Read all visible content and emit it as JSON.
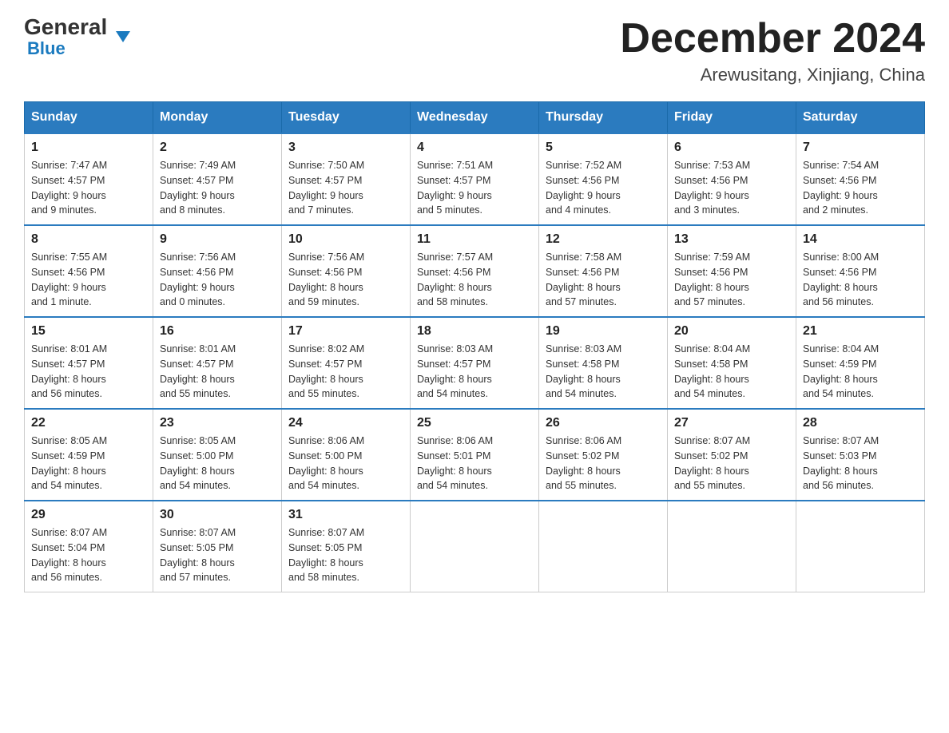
{
  "header": {
    "logo_general": "General",
    "logo_blue": "Blue",
    "month_title": "December 2024",
    "location": "Arewusitang, Xinjiang, China"
  },
  "days_of_week": [
    "Sunday",
    "Monday",
    "Tuesday",
    "Wednesday",
    "Thursday",
    "Friday",
    "Saturday"
  ],
  "weeks": [
    [
      {
        "day": "1",
        "sunrise": "7:47 AM",
        "sunset": "4:57 PM",
        "daylight": "9 hours and 9 minutes."
      },
      {
        "day": "2",
        "sunrise": "7:49 AM",
        "sunset": "4:57 PM",
        "daylight": "9 hours and 8 minutes."
      },
      {
        "day": "3",
        "sunrise": "7:50 AM",
        "sunset": "4:57 PM",
        "daylight": "9 hours and 7 minutes."
      },
      {
        "day": "4",
        "sunrise": "7:51 AM",
        "sunset": "4:57 PM",
        "daylight": "9 hours and 5 minutes."
      },
      {
        "day": "5",
        "sunrise": "7:52 AM",
        "sunset": "4:56 PM",
        "daylight": "9 hours and 4 minutes."
      },
      {
        "day": "6",
        "sunrise": "7:53 AM",
        "sunset": "4:56 PM",
        "daylight": "9 hours and 3 minutes."
      },
      {
        "day": "7",
        "sunrise": "7:54 AM",
        "sunset": "4:56 PM",
        "daylight": "9 hours and 2 minutes."
      }
    ],
    [
      {
        "day": "8",
        "sunrise": "7:55 AM",
        "sunset": "4:56 PM",
        "daylight": "9 hours and 1 minute."
      },
      {
        "day": "9",
        "sunrise": "7:56 AM",
        "sunset": "4:56 PM",
        "daylight": "9 hours and 0 minutes."
      },
      {
        "day": "10",
        "sunrise": "7:56 AM",
        "sunset": "4:56 PM",
        "daylight": "8 hours and 59 minutes."
      },
      {
        "day": "11",
        "sunrise": "7:57 AM",
        "sunset": "4:56 PM",
        "daylight": "8 hours and 58 minutes."
      },
      {
        "day": "12",
        "sunrise": "7:58 AM",
        "sunset": "4:56 PM",
        "daylight": "8 hours and 57 minutes."
      },
      {
        "day": "13",
        "sunrise": "7:59 AM",
        "sunset": "4:56 PM",
        "daylight": "8 hours and 57 minutes."
      },
      {
        "day": "14",
        "sunrise": "8:00 AM",
        "sunset": "4:56 PM",
        "daylight": "8 hours and 56 minutes."
      }
    ],
    [
      {
        "day": "15",
        "sunrise": "8:01 AM",
        "sunset": "4:57 PM",
        "daylight": "8 hours and 56 minutes."
      },
      {
        "day": "16",
        "sunrise": "8:01 AM",
        "sunset": "4:57 PM",
        "daylight": "8 hours and 55 minutes."
      },
      {
        "day": "17",
        "sunrise": "8:02 AM",
        "sunset": "4:57 PM",
        "daylight": "8 hours and 55 minutes."
      },
      {
        "day": "18",
        "sunrise": "8:03 AM",
        "sunset": "4:57 PM",
        "daylight": "8 hours and 54 minutes."
      },
      {
        "day": "19",
        "sunrise": "8:03 AM",
        "sunset": "4:58 PM",
        "daylight": "8 hours and 54 minutes."
      },
      {
        "day": "20",
        "sunrise": "8:04 AM",
        "sunset": "4:58 PM",
        "daylight": "8 hours and 54 minutes."
      },
      {
        "day": "21",
        "sunrise": "8:04 AM",
        "sunset": "4:59 PM",
        "daylight": "8 hours and 54 minutes."
      }
    ],
    [
      {
        "day": "22",
        "sunrise": "8:05 AM",
        "sunset": "4:59 PM",
        "daylight": "8 hours and 54 minutes."
      },
      {
        "day": "23",
        "sunrise": "8:05 AM",
        "sunset": "5:00 PM",
        "daylight": "8 hours and 54 minutes."
      },
      {
        "day": "24",
        "sunrise": "8:06 AM",
        "sunset": "5:00 PM",
        "daylight": "8 hours and 54 minutes."
      },
      {
        "day": "25",
        "sunrise": "8:06 AM",
        "sunset": "5:01 PM",
        "daylight": "8 hours and 54 minutes."
      },
      {
        "day": "26",
        "sunrise": "8:06 AM",
        "sunset": "5:02 PM",
        "daylight": "8 hours and 55 minutes."
      },
      {
        "day": "27",
        "sunrise": "8:07 AM",
        "sunset": "5:02 PM",
        "daylight": "8 hours and 55 minutes."
      },
      {
        "day": "28",
        "sunrise": "8:07 AM",
        "sunset": "5:03 PM",
        "daylight": "8 hours and 56 minutes."
      }
    ],
    [
      {
        "day": "29",
        "sunrise": "8:07 AM",
        "sunset": "5:04 PM",
        "daylight": "8 hours and 56 minutes."
      },
      {
        "day": "30",
        "sunrise": "8:07 AM",
        "sunset": "5:05 PM",
        "daylight": "8 hours and 57 minutes."
      },
      {
        "day": "31",
        "sunrise": "8:07 AM",
        "sunset": "5:05 PM",
        "daylight": "8 hours and 58 minutes."
      },
      null,
      null,
      null,
      null
    ]
  ],
  "labels": {
    "sunrise": "Sunrise:",
    "sunset": "Sunset:",
    "daylight": "Daylight:"
  }
}
